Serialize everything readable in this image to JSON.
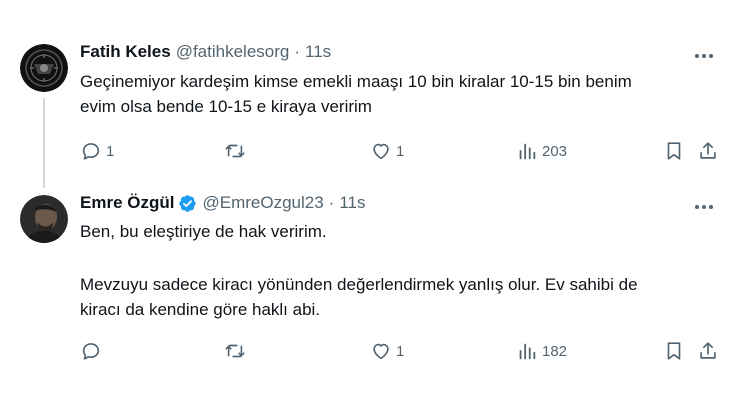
{
  "tweets": [
    {
      "name": "Fatih Keles",
      "handle": "@fatihkelesorg",
      "separator": "·",
      "time": "11s",
      "lines": [
        "Geçinemiyor kardeşim kimse emekli maaşı 10 bin kiralar 10-15 bin benim",
        "evim olsa bende 10-15 e kiraya veririm"
      ],
      "replies": "1",
      "retweets": "",
      "likes": "1",
      "views": "203"
    },
    {
      "name": "Emre Özgül",
      "handle": "@EmreOzgul23",
      "separator": "·",
      "time": "11s",
      "verified": true,
      "lines": [
        "Ben, bu eleştiriye de hak veririm.",
        "",
        "Mevzuyu sadece kiracı yönünden değerlendirmek yanlış olur. Ev sahibi de",
        "kiracı da kendine göre haklı abi."
      ],
      "replies": "",
      "retweets": "",
      "likes": "1",
      "views": "182"
    }
  ],
  "colors": {
    "text": "#0f1419",
    "secondary": "#536471",
    "verified": "#1d9bf0",
    "thread_line": "#cfd9de"
  },
  "icons": {
    "reply": "reply-icon",
    "retweet": "retweet-icon",
    "like": "heart-icon",
    "views": "views-icon",
    "bookmark": "bookmark-icon",
    "share": "share-icon",
    "more": "more-icon",
    "verified": "verified-badge-icon"
  }
}
